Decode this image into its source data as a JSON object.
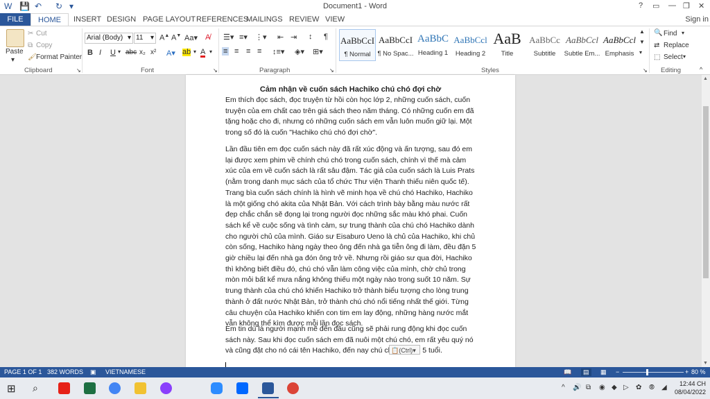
{
  "titlebar": {
    "title": "Document1 - Word",
    "help": "?",
    "minimize": "—",
    "restore": "❐",
    "close": "✕"
  },
  "tabs": {
    "file": "FILE",
    "items": [
      "HOME",
      "INSERT",
      "DESIGN",
      "PAGE LAYOUT",
      "REFERENCES",
      "MAILINGS",
      "REVIEW",
      "VIEW"
    ],
    "signin": "Sign in"
  },
  "ribbon": {
    "clipboard": {
      "paste": "Paste",
      "cut": "Cut",
      "copy": "Copy",
      "format_painter": "Format Painter",
      "label": "Clipboard"
    },
    "font": {
      "name": "Arial (Body)",
      "size": "11",
      "label": "Font"
    },
    "paragraph": {
      "label": "Paragraph"
    },
    "styles": {
      "label": "Styles",
      "items": [
        {
          "sample": "AaBbCcI",
          "name": "¶ Normal"
        },
        {
          "sample": "AaBbCcI",
          "name": "¶ No Spac..."
        },
        {
          "sample": "AaBbC",
          "name": "Heading 1"
        },
        {
          "sample": "AaBbCcl",
          "name": "Heading 2"
        },
        {
          "sample": "AaB",
          "name": "Title"
        },
        {
          "sample": "AaBbCc",
          "name": "Subtitle"
        },
        {
          "sample": "AaBbCcl",
          "name": "Subtle Em..."
        },
        {
          "sample": "AaBbCcl",
          "name": "Emphasis"
        }
      ]
    },
    "editing": {
      "find": "Find",
      "replace": "Replace",
      "select": "Select",
      "label": "Editing"
    }
  },
  "document": {
    "heading": "Cảm nhận về cuốn sách Hachiko chú chó đợi chờ",
    "paragraphs": [
      "Em thích đọc sách, đọc truyện từ hồi còn học lớp 2, những cuốn sách, cuốn truyện của em chất cao trên giá sách theo năm tháng. Có những cuốn em đã tặng hoặc cho đi, nhưng có những cuốn sách em vẫn luôn muốn giữ lại. Một trong số đó là cuốn \"Hachiko chú chó đợi chờ\".",
      "Lần đầu tiên em đọc cuốn sách này đã rất xúc động và ấn tượng, sau đó em lại được xem phim về chính chú chó trong cuốn sách, chính vì thế mà cảm xúc của em về cuốn sách là rất sâu đậm. Tác giả của cuốn sách là Luis Prats (nằm trong danh mục sách của tổ chức Thư viện Thanh thiếu niên quốc tế). Trang bìa cuốn sách chính là hình vẽ minh họa về chú chó Hachiko, Hachiko là một giống chó akita của Nhật Bản. Với cách trình bày bằng màu nước rất đẹp chắc chắn sẽ đọng lại trong người đọc những sắc màu khó phai. Cuốn sách kể về cuộc sống và tình cảm, sự trung thành của chú chó Hachiko dành cho người chủ của mình. Giáo sư Eisaburo Ueno là chủ của Hachiko, khi chủ còn sống, Hachiko hàng ngày theo ông đến nhà ga tiễn ông đi làm, đều đặn 5 giờ chiều lại đến nhà ga đón ông trở về. Nhưng rồi giáo sư qua đời, Hachiko thì không biết điều đó, chú chó vẫn làm công việc của mình, chờ chủ trong mòn mỏi bất kể mưa nắng không thiếu một ngày nào trong suốt 10 năm. Sự trung thành của chú chó khiến Hachiko trở thành biểu tượng cho lòng trung thành ở đất nước Nhật Bản, trở thành chú chó nổi tiếng nhất thế giới. Từng câu chuyện của Hachiko khiến con tim em lay động, những hàng nước mắt vẫn không thể kìm được mỗi lần đọc sách.",
      "Em tin dù là người mạnh mẽ đến đâu cũng sẽ phải rung động khi đọc cuốn sách này. Sau khi đọc cuốn sách em đã nuôi một chú chó, em rất yêu quý nó và cũng đặt cho nó cái tên Hachiko, đến nay chú chó đã gần 5 tuổi."
    ],
    "paste_options": "(Ctrl)"
  },
  "statusbar": {
    "page": "PAGE 1 OF 1",
    "words": "382 WORDS",
    "language": "VIETNAMESE",
    "zoom": "80 %",
    "zoom_level_percent": 80
  },
  "taskbar": {
    "time": "12:44 CH",
    "date": "08/04/2022",
    "apps": [
      {
        "icon": "youtube-icon",
        "color": "#e62117"
      },
      {
        "icon": "excel-icon",
        "color": "#1d6f42"
      },
      {
        "icon": "chrome-color-icon",
        "color": "#4285f4"
      },
      {
        "icon": "folder-icon",
        "color": "#f1c232"
      },
      {
        "icon": "messenger-icon",
        "color": "#8a3ffc"
      },
      {
        "icon": "zoom-icon",
        "color": "#2d8cff"
      },
      {
        "icon": "zalo-icon",
        "color": "#0068ff"
      },
      {
        "icon": "word-icon",
        "color": "#2b579a"
      },
      {
        "icon": "chrome-icon",
        "color": "#db4437"
      }
    ]
  },
  "colors": {
    "accent": "#2b579a",
    "statusbar": "#2b579a"
  }
}
